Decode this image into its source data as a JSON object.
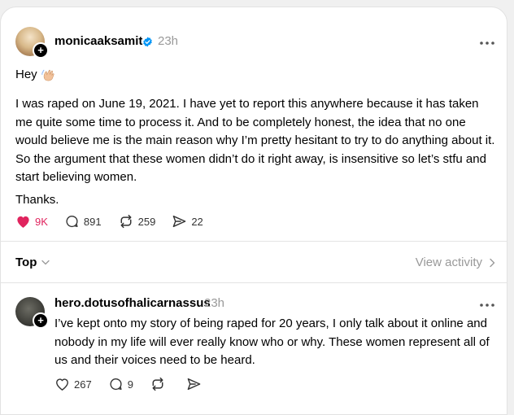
{
  "post": {
    "username": "monicaaksamit",
    "time": "23h",
    "greeting": "Hey",
    "body": "I was raped on June 19, 2021. I have yet to report this anywhere because it has taken me quite some time to process it. And to be completely honest, the idea that no one would believe me is the main reason why I’m pretty hesitant to try to do anything about it. So the argument that these women didn’t do it right away, is insensitive so let’s stfu and start believing women.",
    "closing": "Thanks.",
    "likes": "9K",
    "replies": "891",
    "reposts": "259",
    "shares": "22"
  },
  "replies_header": {
    "sort_label": "Top",
    "view_activity": "View activity"
  },
  "reply": {
    "username": "hero.dotusofhalicarnassus",
    "time": "23h",
    "body": "I’ve kept onto my story of being raped for 20 years, I only talk about it online and nobody in my life will ever really know who or why. These women represent all of us and their voices need to be heard.",
    "likes": "267",
    "replies": "9"
  },
  "colors": {
    "like_active": "#e0245e",
    "verified": "#0095f6",
    "muted_text": "#999999"
  },
  "icons": [
    "verified-badge-icon",
    "more-icon",
    "heart-icon",
    "reply-icon",
    "repost-icon",
    "share-icon",
    "chevron-down-icon",
    "chevron-right-icon",
    "waving-hand-icon"
  ]
}
